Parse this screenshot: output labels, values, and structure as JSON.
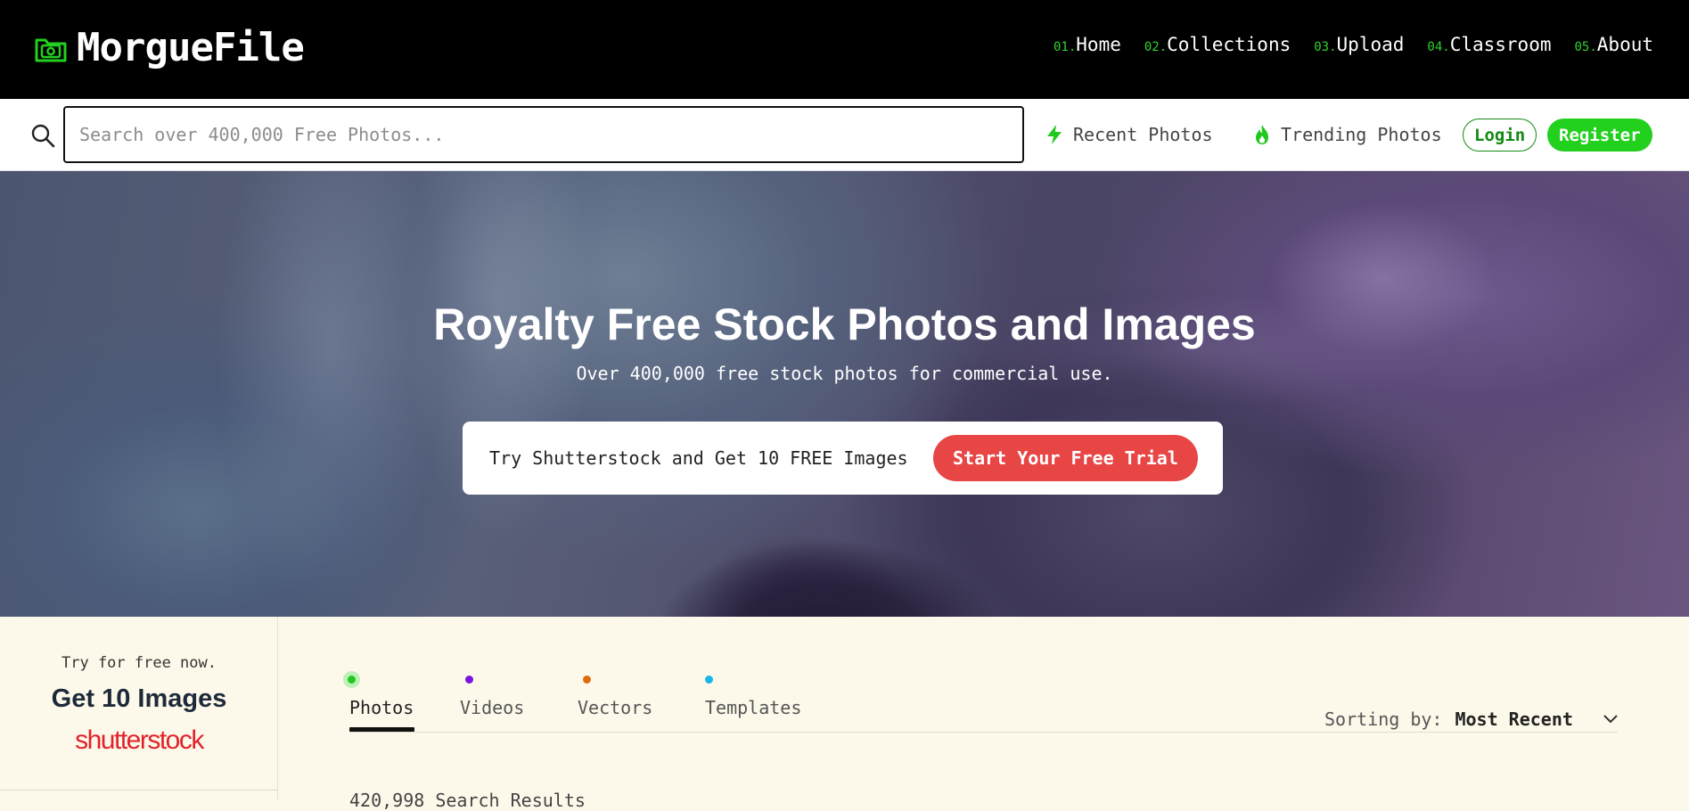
{
  "header": {
    "logo_text": "MorgueFile",
    "nav": [
      {
        "num": "01.",
        "label": "Home"
      },
      {
        "num": "02.",
        "label": "Collections"
      },
      {
        "num": "03.",
        "label": "Upload"
      },
      {
        "num": "04.",
        "label": "Classroom"
      },
      {
        "num": "05.",
        "label": "About"
      }
    ]
  },
  "search": {
    "placeholder": "Search over 400,000 Free Photos...",
    "recent_label": "Recent Photos",
    "trending_label": "Trending Photos",
    "login_label": "Login",
    "register_label": "Register"
  },
  "hero": {
    "title": "Royalty Free Stock Photos and Images",
    "subtitle": "Over 400,000 free stock photos for commercial use.",
    "promo_text": "Try Shutterstock and Get 10 FREE Images",
    "promo_cta": "Start Your Free Trial"
  },
  "sidebar": {
    "try_text": "Try for free now.",
    "get_text": "Get 10 Images",
    "brand": "shutterstock"
  },
  "tabs": [
    {
      "label": "Photos",
      "dot_color": "#22c81e",
      "active": true
    },
    {
      "label": "Videos",
      "dot_color": "#7a16e0",
      "active": false
    },
    {
      "label": "Vectors",
      "dot_color": "#e06a10",
      "active": false
    },
    {
      "label": "Templates",
      "dot_color": "#18b6e8",
      "active": false
    }
  ],
  "sort": {
    "label": "Sorting by:",
    "value": "Most Recent"
  },
  "results_text": "420,998 Search Results",
  "colors": {
    "accent_green": "#22d01e",
    "cta_red": "#e84545",
    "login_green": "#138a13"
  }
}
